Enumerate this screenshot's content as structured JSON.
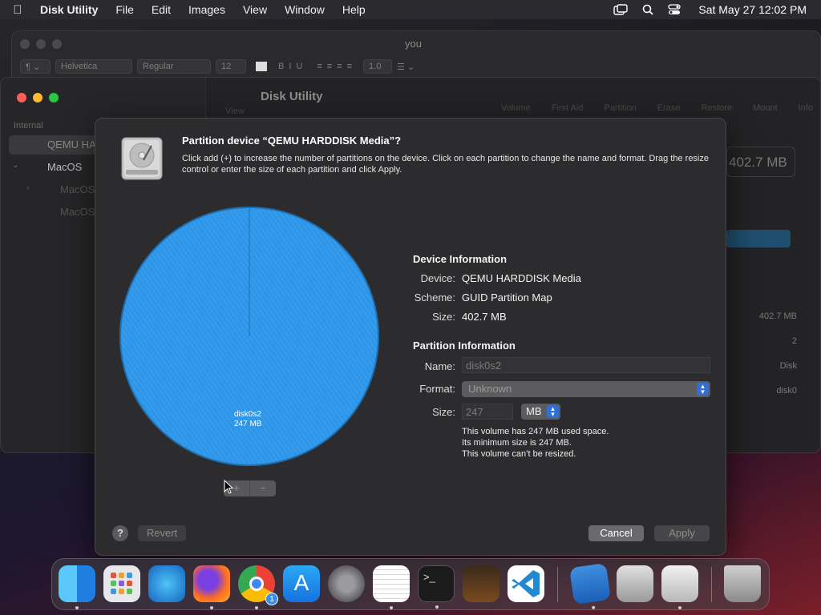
{
  "menubar": {
    "app": "Disk Utility",
    "items": [
      "File",
      "Edit",
      "Images",
      "View",
      "Window",
      "Help"
    ],
    "clock": "Sat May 27  12:02 PM",
    "status_icons": [
      "screen-mirror-icon",
      "search-icon",
      "control-center-icon"
    ]
  },
  "textedit": {
    "title": "you",
    "font": "Helvetica",
    "style": "Regular",
    "size": "12",
    "spacing": "1.0"
  },
  "diskutility": {
    "title": "Disk Utility",
    "view_label": "View",
    "toolbar": [
      "Volume",
      "First Aid",
      "Partition",
      "Erase",
      "Restore",
      "Mount",
      "Info"
    ],
    "sidebar_header": "Internal",
    "sidebar_items": [
      "QEMU HA",
      "MacOS",
      "MacOS",
      "MacOS"
    ],
    "capacity": "402.7 MB",
    "info_values": [
      "402.7 MB",
      "2",
      "Disk",
      "disk0"
    ]
  },
  "sheet": {
    "title": "Partition device “QEMU HARDDISK Media”?",
    "description": "Click add (+) to increase the number of partitions on the device. Click on each partition to change the name and format. Drag the resize control or enter the size of each partition and click Apply.",
    "pie_label_name": "disk0s2",
    "pie_label_size": "247 MB",
    "add_label": "+",
    "remove_label": "−",
    "device_info": {
      "heading": "Device Information",
      "device_label": "Device:",
      "device": "QEMU HARDDISK Media",
      "scheme_label": "Scheme:",
      "scheme": "GUID Partition Map",
      "size_label": "Size:",
      "size": "402.7 MB"
    },
    "partition_info": {
      "heading": "Partition Information",
      "name_label": "Name:",
      "name": "disk0s2",
      "format_label": "Format:",
      "format": "Unknown",
      "size_label": "Size:",
      "size": "247",
      "unit": "MB"
    },
    "notes": [
      "This volume has 247 MB used space.",
      "Its minimum size is 247 MB.",
      "This volume can’t be resized."
    ],
    "help": "?",
    "revert": "Revert",
    "cancel": "Cancel",
    "apply": "Apply",
    "pie_color": "#2e96e8"
  },
  "dock": {
    "apps": [
      "finder-icon",
      "launchpad-icon",
      "safari-icon",
      "firefox-icon",
      "chrome-icon",
      "app-store-icon",
      "system-settings-icon",
      "textedit-icon",
      "terminal-icon",
      "garageband-icon",
      "vscode-icon",
      "sysprefs-utility-icon",
      "boot-camp-icon",
      "disk-utility-icon",
      "trash-icon"
    ],
    "chrome_badge": "1"
  }
}
